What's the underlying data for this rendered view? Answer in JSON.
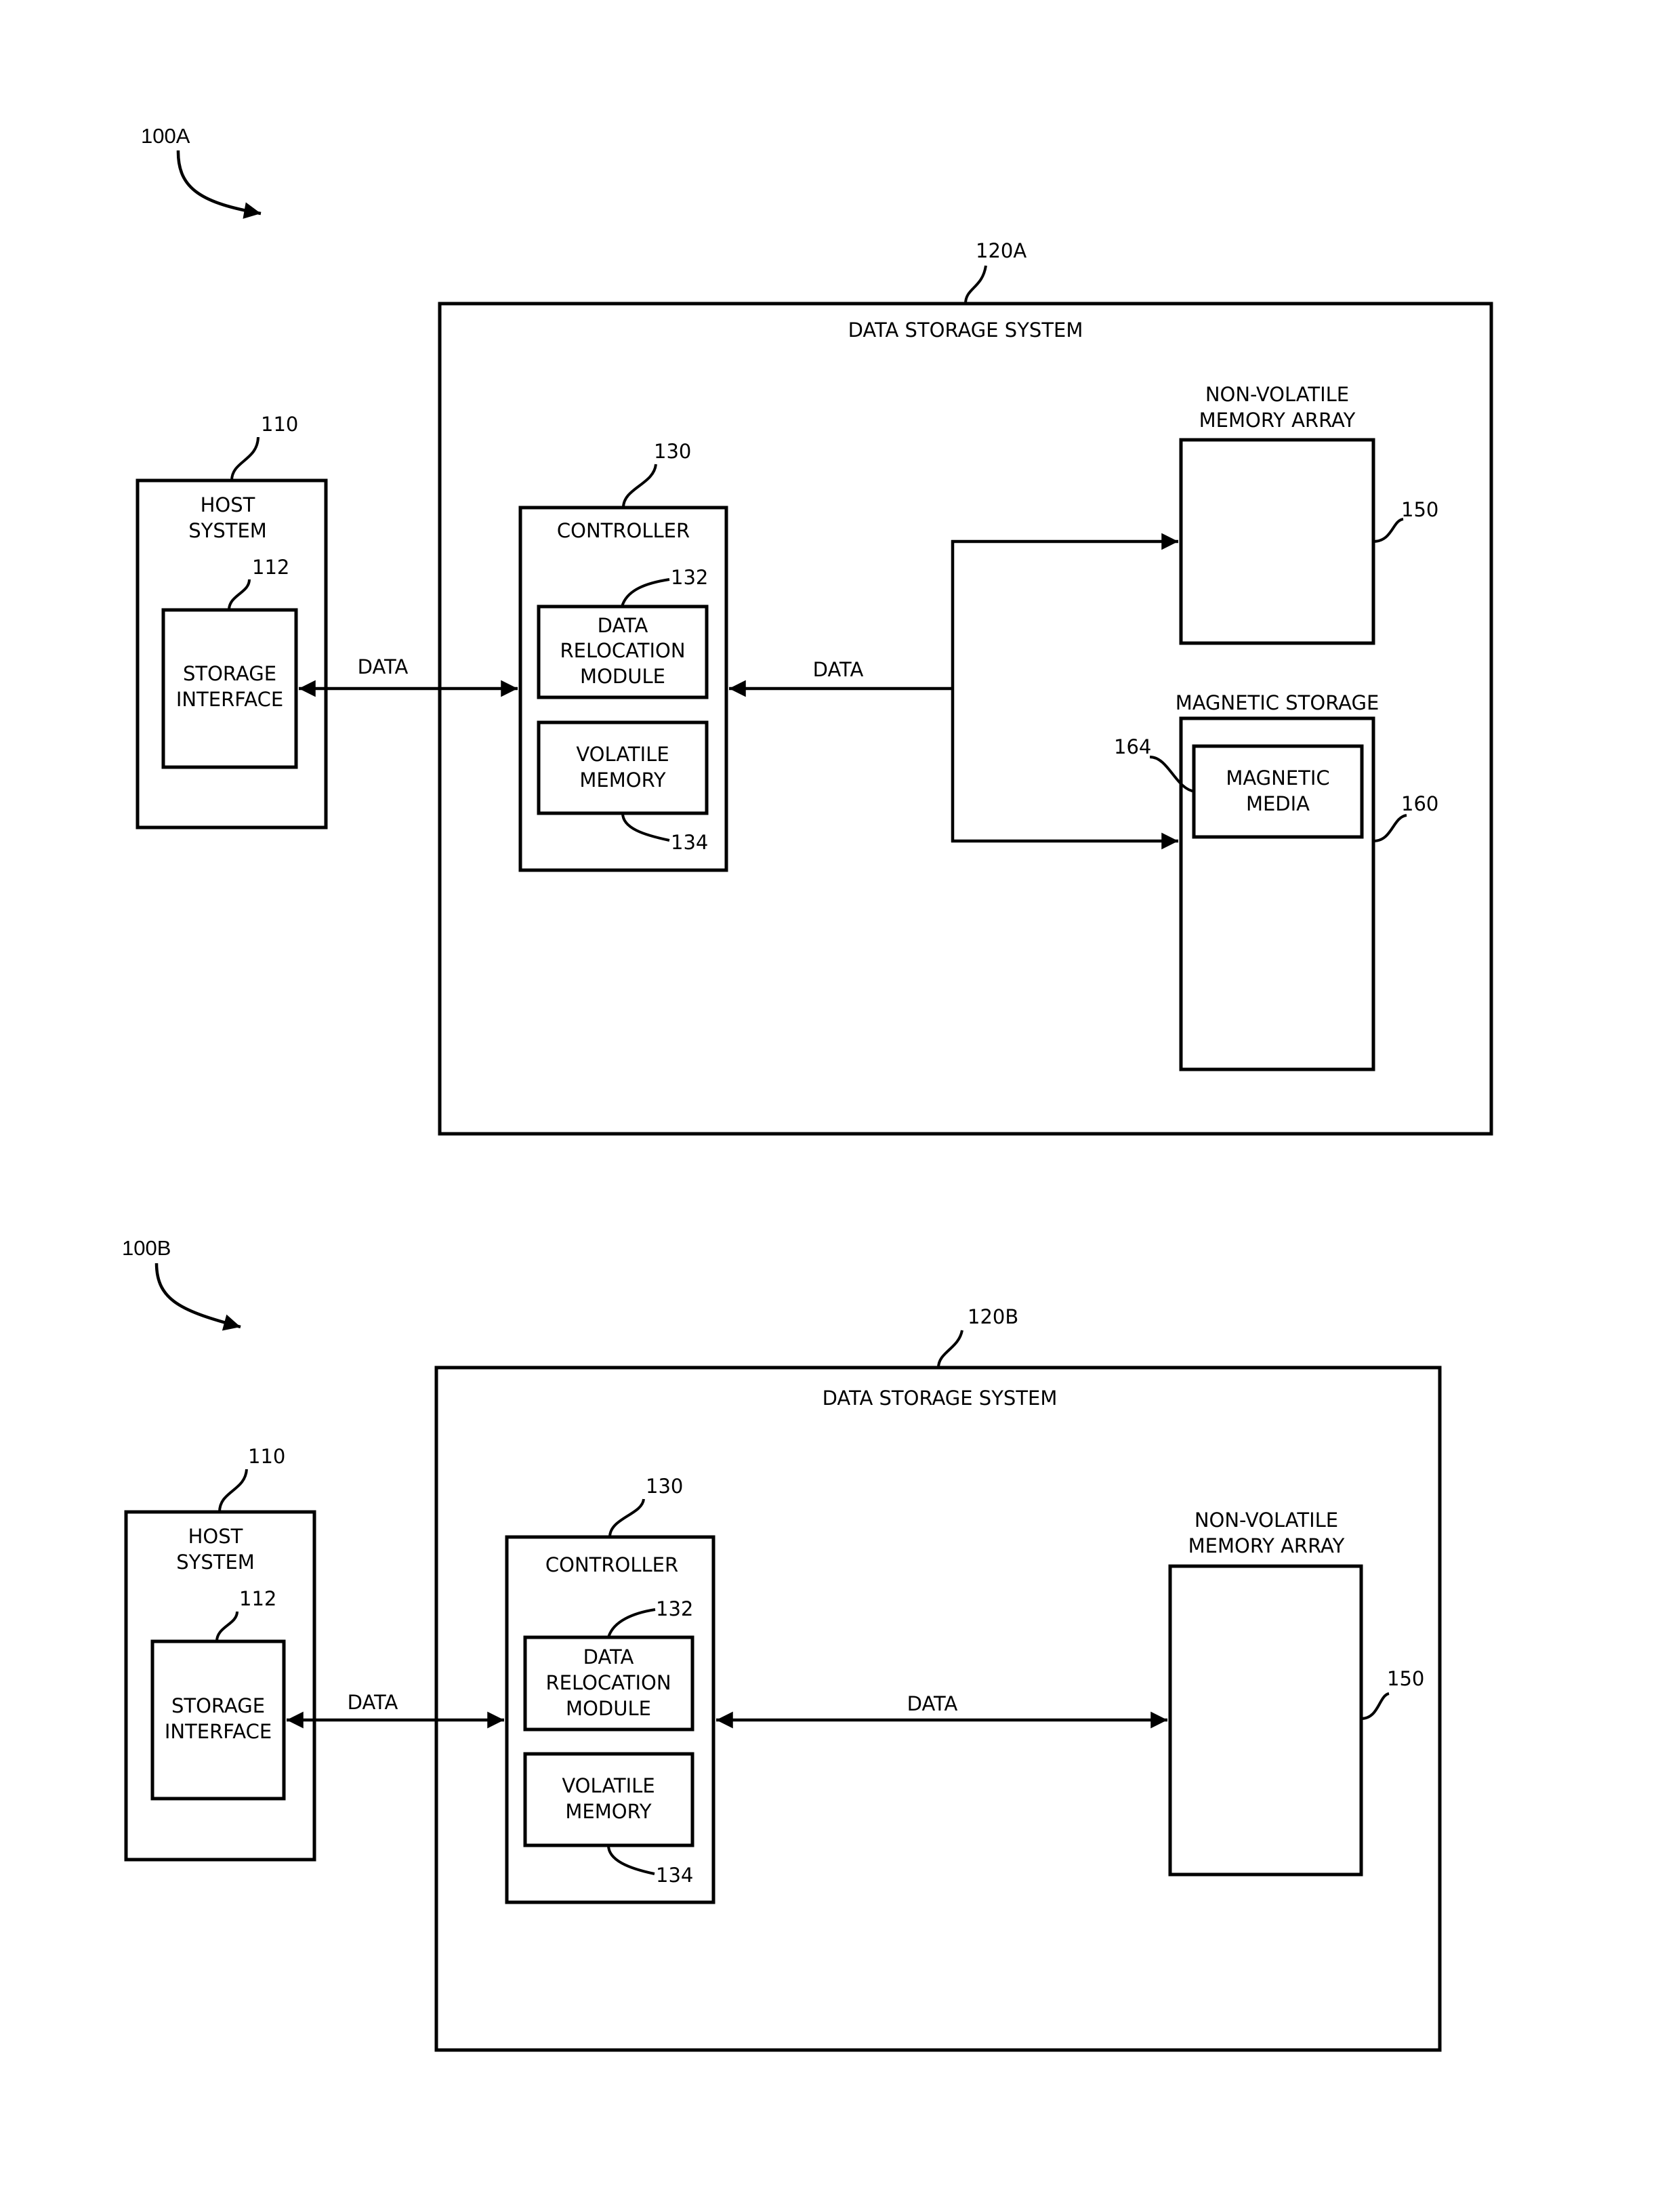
{
  "figures": [
    {
      "id_label": "100A",
      "system_ref": "120A",
      "system_title": "DATA STORAGE SYSTEM",
      "host": {
        "ref": "110",
        "title_lines": [
          "HOST",
          "SYSTEM"
        ],
        "interface_ref": "112",
        "interface_lines": [
          "STORAGE",
          "INTERFACE"
        ]
      },
      "host_link_label": "DATA",
      "controller": {
        "ref": "130",
        "title": "CONTROLLER",
        "relocation_ref": "132",
        "relocation_lines": [
          "DATA",
          "RELOCATION",
          "MODULE"
        ],
        "volatile_ref": "134",
        "volatile_lines": [
          "VOLATILE",
          "MEMORY"
        ]
      },
      "storage_link_label": "DATA",
      "nvm": {
        "ref": "150",
        "title_lines": [
          "NON-VOLATILE",
          "MEMORY ARRAY"
        ]
      },
      "magnetic": {
        "ref": "160",
        "title": "MAGNETIC STORAGE",
        "media_ref": "164",
        "media_lines": [
          "MAGNETIC",
          "MEDIA"
        ]
      }
    },
    {
      "id_label": "100B",
      "system_ref": "120B",
      "system_title": "DATA STORAGE SYSTEM",
      "host": {
        "ref": "110",
        "title_lines": [
          "HOST",
          "SYSTEM"
        ],
        "interface_ref": "112",
        "interface_lines": [
          "STORAGE",
          "INTERFACE"
        ]
      },
      "host_link_label": "DATA",
      "controller": {
        "ref": "130",
        "title": "CONTROLLER",
        "relocation_ref": "132",
        "relocation_lines": [
          "DATA",
          "RELOCATION",
          "MODULE"
        ],
        "volatile_ref": "134",
        "volatile_lines": [
          "VOLATILE",
          "MEMORY"
        ]
      },
      "storage_link_label": "DATA",
      "nvm": {
        "ref": "150",
        "title_lines": [
          "NON-VOLATILE",
          "MEMORY ARRAY"
        ]
      }
    }
  ]
}
